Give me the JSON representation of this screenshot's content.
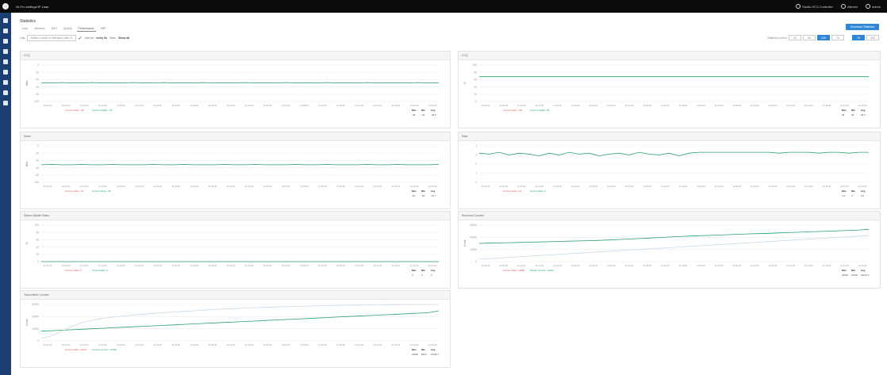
{
  "topbar": {
    "title": "NI-Pro settings/IP 1aaa",
    "items": [
      "Studio HC3 Controller",
      "Alleven",
      "admin"
    ]
  },
  "page": {
    "title": "Statistics",
    "tabs": [
      "Links",
      "Wireless",
      "WiFi",
      "Quality",
      "Performance",
      "RBP"
    ],
    "active_tab": 4
  },
  "filters": {
    "device_label": "Link",
    "device_value": "Select a node or interface (Aleri 2)",
    "interval_label": "Interval",
    "interval_value": "every 5s",
    "stats_label": "Stats",
    "stats_value": "Show all"
  },
  "export_label": "Download Statistics",
  "range": {
    "label": "Statistics period",
    "buttons": [
      "1h",
      "6h",
      "24h",
      "7d",
      "30d"
    ],
    "active": [
      2,
      3
    ]
  },
  "time_ticks": [
    "11:02:00",
    "11:06:00",
    "11:10:00",
    "11:14:00",
    "11:18:00",
    "11:22:00",
    "11:26:00",
    "11:30:00",
    "11:34:00",
    "11:38:00",
    "11:42:00",
    "11:46:00",
    "11:50:00",
    "11:54:00",
    "11:58:00",
    "12:02:00",
    "12:06:00",
    "12:10:00",
    "12:14:00",
    "12:18:00",
    "12:22:00",
    "12:26:00"
  ],
  "colors": {
    "line": "#27a069",
    "line2": "#d95a5a",
    "grid": "#ececec",
    "accent": "#2f86d6"
  },
  "chart_data": [
    {
      "type": "line",
      "title": "CCQ",
      "ylabel": "dBm",
      "ylim": [
        -100,
        0
      ],
      "yticks": [
        0,
        -20,
        -40,
        -60,
        -80,
        -100
      ],
      "series": [
        {
          "name": "",
          "values": [
            -49,
            -49,
            -48,
            -49,
            -49,
            -48,
            -49,
            -49,
            -49,
            -48,
            -49,
            -49,
            -48,
            -49,
            -49,
            -49,
            -48,
            -49,
            -49,
            -49,
            -48,
            -49,
            -49,
            -49,
            -48,
            -49,
            -49,
            -49,
            -48,
            -49,
            -49,
            -49,
            -48,
            -49,
            -49,
            -49,
            -49,
            -48,
            -49,
            -49
          ]
        }
      ],
      "legend": [
        "Current Value: -48",
        "Current Quality: -78"
      ],
      "summary": {
        "headers": [
          "Max",
          "Min",
          "Avg"
        ],
        "values": [
          "-48",
          "-49",
          "-48.6"
        ]
      }
    },
    {
      "type": "line",
      "title": "CCQ",
      "ylabel": "%",
      "ylim": [
        0,
        100
      ],
      "yticks": [
        100,
        80,
        60,
        40,
        20,
        0
      ],
      "series": [
        {
          "name": "",
          "values": [
            68,
            68,
            68,
            68,
            68,
            68,
            68,
            68,
            68,
            68,
            68,
            68,
            68,
            68,
            68,
            68,
            68,
            68,
            68,
            68,
            68,
            68,
            68,
            68,
            68,
            68,
            68,
            68,
            68,
            68,
            68,
            68,
            68,
            68,
            68,
            68,
            68,
            68,
            68,
            68
          ]
        }
      ],
      "legend": [
        "Current Value: 100",
        "Current Quality: 68"
      ],
      "summary": {
        "headers": [
          "Max",
          "Min",
          "Avg"
        ],
        "values": [
          "68",
          "68",
          "68.0"
        ]
      }
    },
    {
      "type": "line",
      "title": "Noise",
      "ylabel": "dBm",
      "ylim": [
        -100,
        0
      ],
      "yticks": [
        0,
        -20,
        -40,
        -60,
        -80,
        -100
      ],
      "series": [
        {
          "name": "",
          "values": [
            -52,
            -51,
            -52,
            -52,
            -51,
            -52,
            -52,
            -51,
            -52,
            -52,
            -52,
            -51,
            -52,
            -52,
            -51,
            -52,
            -52,
            -52,
            -51,
            -52,
            -52,
            -51,
            -52,
            -52,
            -52,
            -51,
            -52,
            -52,
            -51,
            -52,
            -52,
            -52,
            -51,
            -52,
            -52,
            -51,
            -52,
            -52,
            -52,
            -51
          ]
        }
      ],
      "legend": [
        "Current Value: -52",
        "Current Noise: -96"
      ],
      "summary": {
        "headers": [
          "Max",
          "Min",
          "Avg"
        ],
        "values": [
          "-51",
          "-52",
          "-51.7"
        ]
      }
    },
    {
      "type": "line",
      "title": "Rate",
      "ylabel": "",
      "ylim": [
        0,
        4
      ],
      "yticks": [
        4,
        3,
        2,
        1,
        0
      ],
      "series": [
        {
          "name": "",
          "values": [
            3.2,
            3.1,
            3.3,
            3.0,
            3.2,
            3.1,
            2.9,
            3.2,
            3.0,
            3.3,
            3.1,
            3.2,
            2.9,
            3.1,
            3.2,
            3.0,
            3.3,
            3.1,
            3.0,
            3.2,
            2.9,
            3.2,
            3.3,
            3.3,
            3.3,
            3.3,
            3.3,
            3.3,
            3.3,
            3.3,
            3.2,
            3.3,
            3.3,
            3.3,
            3.2,
            3.3,
            3.3,
            3.2,
            3.3,
            3.3
          ]
        }
      ],
      "legend": [
        "Current Value: 3.3",
        "Current Rate: 3"
      ],
      "summary": {
        "headers": [
          "Max",
          "Min",
          "Avg"
        ],
        "values": [
          "3.4",
          "3",
          "3.2"
        ]
      }
    },
    {
      "type": "line",
      "title": "Station Bitrate Rates",
      "ylabel": "%",
      "ylim": [
        0,
        100
      ],
      "yticks": [
        100,
        80,
        60,
        40,
        20,
        0
      ],
      "series": [
        {
          "name": "",
          "values": [
            0,
            0,
            0,
            0,
            0,
            0,
            0,
            0,
            0,
            0,
            0,
            0,
            0,
            0,
            0,
            0,
            0,
            0,
            0,
            0,
            0,
            0,
            0,
            0,
            0,
            0,
            0,
            0,
            0,
            0,
            0,
            0,
            0,
            0,
            0,
            0,
            0,
            0,
            0,
            0
          ]
        }
      ],
      "legend": [
        "Current Value: 0",
        "Current Rate: 0"
      ],
      "summary": {
        "headers": [
          "Max",
          "Min",
          "Avg"
        ],
        "values": [
          "0",
          "0",
          "0"
        ]
      }
    },
    {
      "type": "line",
      "title": "Received Counter",
      "ylabel": "Count",
      "ylim": [
        0,
        30000
      ],
      "yticks": [
        30000,
        20000,
        10000,
        0
      ],
      "series": [
        {
          "name": "",
          "color": "#27a069",
          "values": [
            15000,
            15200,
            15400,
            15600,
            15800,
            16000,
            16200,
            16400,
            16600,
            16800,
            17000,
            17200,
            17500,
            17800,
            18200,
            18600,
            19000,
            19400,
            19800,
            20200,
            20600,
            21000,
            21300,
            21600,
            21900,
            22200,
            22500,
            22800,
            23000,
            23300,
            23600,
            23900,
            24200,
            24500,
            24800,
            25100,
            25400,
            25700,
            26000,
            26600
          ]
        },
        {
          "name": "",
          "color": "#c9d9ea",
          "values": [
            2000,
            2500,
            3000,
            3500,
            4000,
            4500,
            5000,
            5500,
            6000,
            6500,
            7000,
            7500,
            8000,
            8500,
            9000,
            9500,
            10000,
            10500,
            11000,
            11500,
            12000,
            12500,
            13000,
            13500,
            14000,
            14500,
            15000,
            15500,
            16000,
            16500,
            17000,
            17500,
            18000,
            18500,
            19000,
            19500,
            20000,
            20500,
            21000,
            21500
          ]
        }
      ],
      "legend": [
        "Current Value: 13886",
        "Packet Counter: 10044"
      ],
      "summary": {
        "headers": [
          "Max",
          "Min",
          "Avg"
        ],
        "values": [
          "26600",
          "15000",
          "20614.3"
        ]
      }
    },
    {
      "type": "line",
      "title": "Transmitted Counter",
      "ylabel": "Count",
      "ylim": [
        0,
        30000
      ],
      "yticks": [
        30000,
        20000,
        10000,
        0
      ],
      "series": [
        {
          "name": "",
          "color": "#27a069",
          "values": [
            8000,
            8400,
            8800,
            9200,
            9600,
            10000,
            10400,
            10800,
            11200,
            11600,
            12000,
            12400,
            12800,
            13200,
            13600,
            14000,
            14400,
            14800,
            15200,
            15600,
            16000,
            16400,
            16800,
            17200,
            17600,
            18000,
            18400,
            18800,
            19200,
            19600,
            20000,
            20400,
            20800,
            21200,
            21600,
            22000,
            22400,
            22800,
            23200,
            24800
          ]
        },
        {
          "name": "",
          "color": "#c9d9ea",
          "values": [
            2000,
            4000,
            8000,
            12000,
            15000,
            17000,
            18500,
            19500,
            20500,
            21300,
            22000,
            22600,
            23200,
            23800,
            24300,
            24800,
            25300,
            25800,
            26200,
            26600,
            27000,
            27300,
            27600,
            27900,
            28200,
            28400,
            28600,
            28800,
            29000,
            29200,
            29400,
            29500,
            29600,
            29700,
            29800,
            29850,
            29900,
            29950,
            30000,
            30000
          ]
        }
      ],
      "legend": [
        "Current Value: 24670",
        "Current Counter: 17458"
      ],
      "summary": {
        "headers": [
          "Max",
          "Min",
          "Avg"
        ],
        "values": [
          "24800",
          "8000",
          "16118.7"
        ]
      }
    }
  ]
}
